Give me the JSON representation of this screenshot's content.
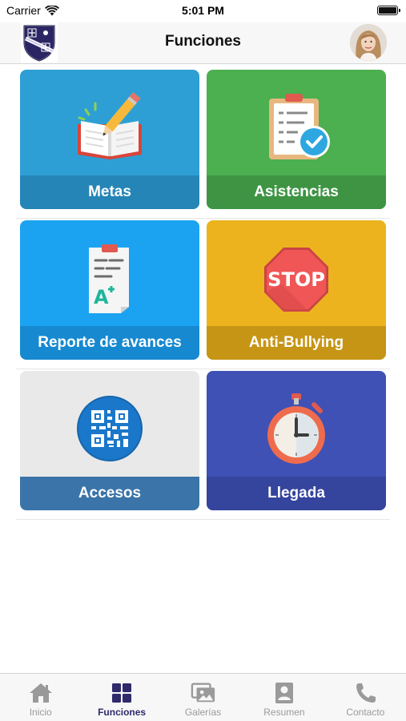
{
  "status_bar": {
    "carrier": "Carrier",
    "time": "5:01 PM"
  },
  "header": {
    "title": "Funciones"
  },
  "tiles": [
    {
      "label": "Metas",
      "icon": "open-book-pencil-icon",
      "color": "#2e9fd4",
      "band": "#2585b6"
    },
    {
      "label": "Asistencias",
      "icon": "attendance-clipboard-icon",
      "color": "#4caf50",
      "band": "#3e9443"
    },
    {
      "label": "Reporte de avances",
      "icon": "graded-report-icon",
      "color": "#1ba3f2",
      "band": "#1689d0"
    },
    {
      "label": "Anti-Bullying",
      "icon": "stop-sign-icon",
      "color": "#ecb31e",
      "band": "#c69516"
    },
    {
      "label": "Accesos",
      "icon": "qr-code-icon",
      "color": "#e9e9e9",
      "band": "#3a74a8"
    },
    {
      "label": "Llegada",
      "icon": "stopwatch-icon",
      "color": "#3f51b5",
      "band": "#35449c"
    }
  ],
  "tab_bar": [
    {
      "label": "Inicio",
      "icon": "home-icon",
      "active": false
    },
    {
      "label": "Funciones",
      "icon": "grid-icon",
      "active": true
    },
    {
      "label": "Galerías",
      "icon": "gallery-icon",
      "active": false
    },
    {
      "label": "Resumen",
      "icon": "profile-card-icon",
      "active": false
    },
    {
      "label": "Contacto",
      "icon": "phone-icon",
      "active": false
    }
  ],
  "colors": {
    "active_tab": "#2f2a6b",
    "inactive_tab": "#9a9a9a"
  }
}
